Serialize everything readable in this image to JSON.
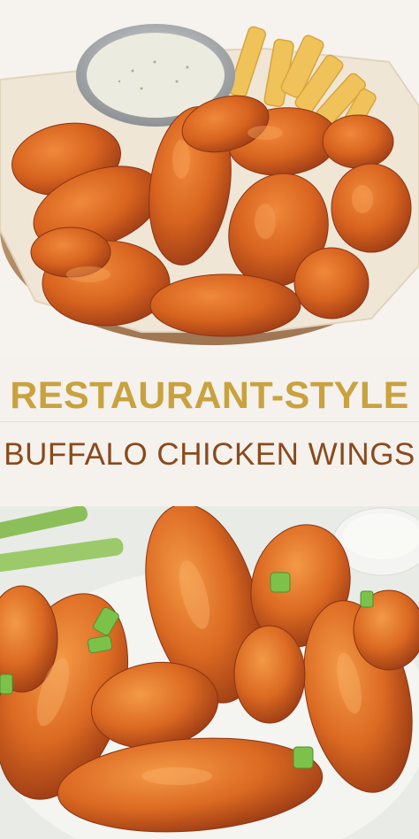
{
  "title": {
    "line1": "RESTAURANT-STYLE",
    "line2": "BUFFALO CHICKEN WINGS"
  },
  "colors": {
    "title_line1": "#c9a23f",
    "title_line2": "#8a4a1c",
    "band_background": "#f5f2ee",
    "wing_orange": "#d8641f",
    "wing_dark": "#a6421a",
    "ranch": "#ecebdf",
    "fries": "#f0c35a"
  },
  "images": {
    "top": "basket-of-wings-with-ranch-and-fries",
    "bottom": "plate-of-wings-with-green-onion"
  }
}
